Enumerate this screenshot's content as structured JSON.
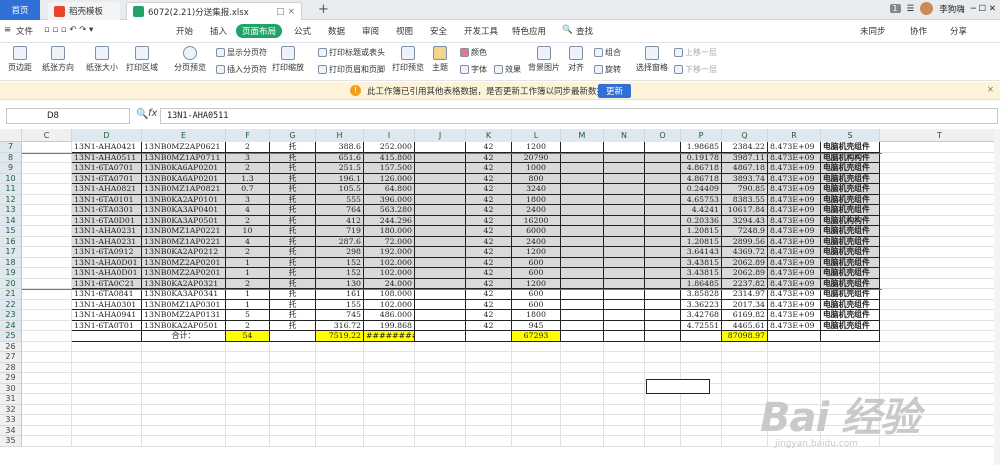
{
  "titlebar": {
    "home_tab": "首页",
    "tab1": "稻壳模板",
    "tab2": "6072(2.21)分送集报.xlsx",
    "add_tab": "+",
    "page_num": "1",
    "user": "李狗嗨"
  },
  "menu": {
    "file": "文件",
    "items": [
      "开始",
      "插入",
      "页面布局",
      "公式",
      "数据",
      "审阅",
      "视图",
      "安全",
      "开发工具",
      "特色应用",
      "查找"
    ],
    "active_index": 2,
    "right": [
      "未同步",
      "协作",
      "分享"
    ]
  },
  "ribbon": {
    "items": [
      "页边距",
      "纸张方向",
      "纸张大小",
      "打印区域",
      "分页预览",
      "显示分页符",
      "插入分页符",
      "打印缩放",
      "打印标题或表头",
      "打印页眉和页脚",
      "打印预览",
      "主题",
      "颜色",
      "字体",
      "效果",
      "背景图片",
      "对齐",
      "组合",
      "旋转",
      "选择窗格",
      "上移一层",
      "下移一层"
    ]
  },
  "notification": {
    "message": "此工作簿已引用其他表格数据，是否更新工作簿以同步最新数据？",
    "update_button": "更新",
    "close": "×"
  },
  "formula_bar": {
    "cell_ref": "D8",
    "zoom_icon": "🔍",
    "fx": "fx",
    "value": "13N1-AHA0511"
  },
  "columns": [
    "C",
    "D",
    "E",
    "F",
    "G",
    "H",
    "I",
    "J",
    "K",
    "L",
    "M",
    "N",
    "O",
    "P",
    "Q",
    "R",
    "S",
    "T"
  ],
  "rows": [
    {
      "n": "7",
      "D": "13N1-AHA0421",
      "E": "13NB0MZ2AP0621",
      "F": "2",
      "G": "托",
      "H": "388.6",
      "I": "252.000",
      "K": "42",
      "L": "1200",
      "P": "1.98685",
      "Q": "2384.22",
      "R": "8.473E+09",
      "S": "电脑机壳组件",
      "hl": false
    },
    {
      "n": "8",
      "D": "13N1-AHA0511",
      "E": "13NB0MZ1AP0711",
      "F": "3",
      "G": "托",
      "H": "651.6",
      "I": "415.800",
      "K": "42",
      "L": "20790",
      "P": "0.19178",
      "Q": "3987.11",
      "R": "8.473E+09",
      "S": "电脑机构构件",
      "hl": true
    },
    {
      "n": "9",
      "D": "13N1-6TA0701",
      "E": "13NB0KA6AP0201",
      "F": "2",
      "G": "托",
      "H": "251.5",
      "I": "157.500",
      "K": "42",
      "L": "1000",
      "P": "4.86718",
      "Q": "4867.18",
      "R": "8.473E+09",
      "S": "电脑机壳组件",
      "hl": true
    },
    {
      "n": "10",
      "D": "13N1-6TA0701",
      "E": "13NB0KA6AP0201",
      "F": "1.3",
      "G": "托",
      "H": "196.1",
      "I": "126.000",
      "K": "42",
      "L": "800",
      "P": "4.86718",
      "Q": "3893.74",
      "R": "8.473E+09",
      "S": "电脑机壳组件",
      "hl": true
    },
    {
      "n": "11",
      "D": "13N1-AHA0821",
      "E": "13NB0MZ1AP0821",
      "F": "0.7",
      "G": "托",
      "H": "105.5",
      "I": "64.800",
      "K": "42",
      "L": "3240",
      "P": "0.24409",
      "Q": "790.85",
      "R": "8.473E+09",
      "S": "电脑机壳组件",
      "hl": true
    },
    {
      "n": "12",
      "D": "13N1-6TA0101",
      "E": "13NB0KA2AP0101",
      "F": "3",
      "G": "托",
      "H": "555",
      "I": "396.000",
      "K": "42",
      "L": "1800",
      "P": "4.65753",
      "Q": "8383.55",
      "R": "8.473E+09",
      "S": "电脑机壳组件",
      "hl": true
    },
    {
      "n": "13",
      "D": "13N1-6TA0301",
      "E": "13NB0KA3AP0401",
      "F": "4",
      "G": "托",
      "H": "764",
      "I": "563.280",
      "K": "42",
      "L": "2400",
      "P": "4.4241",
      "Q": "10617.84",
      "R": "8.473E+09",
      "S": "电脑机壳组件",
      "hl": true
    },
    {
      "n": "14",
      "D": "13N1-6TA0D01",
      "E": "13NB0KA3AP0501",
      "F": "2",
      "G": "托",
      "H": "412",
      "I": "244.296",
      "K": "42",
      "L": "16200",
      "P": "0.20336",
      "Q": "3294.43",
      "R": "8.473E+09",
      "S": "电脑机构构件",
      "hl": true
    },
    {
      "n": "15",
      "D": "13N1-AHA0231",
      "E": "13NB0MZ1AP0221",
      "F": "10",
      "G": "托",
      "H": "719",
      "I": "180.000",
      "K": "42",
      "L": "6000",
      "P": "1.20815",
      "Q": "7248.9",
      "R": "8.473E+09",
      "S": "电脑机壳组件",
      "hl": true
    },
    {
      "n": "16",
      "D": "13N1-AHA0231",
      "E": "13NB0MZ1AP0221",
      "F": "4",
      "G": "托",
      "H": "287.6",
      "I": "72.000",
      "K": "42",
      "L": "2400",
      "P": "1.20815",
      "Q": "2899.56",
      "R": "8.473E+09",
      "S": "电脑机壳组件",
      "hl": true
    },
    {
      "n": "17",
      "D": "13N1-6TA0912",
      "E": "13NB0KA2AP0212",
      "F": "2",
      "G": "托",
      "H": "298",
      "I": "192.000",
      "K": "42",
      "L": "1200",
      "P": "3.64143",
      "Q": "4369.72",
      "R": "8.473E+09",
      "S": "电脑机壳组件",
      "hl": true
    },
    {
      "n": "18",
      "D": "13N1-AHA0D01",
      "E": "13NB0MZ2AP0201",
      "F": "1",
      "G": "托",
      "H": "152",
      "I": "102.000",
      "K": "42",
      "L": "600",
      "P": "3.43815",
      "Q": "2062.89",
      "R": "8.473E+09",
      "S": "电脑机壳组件",
      "hl": true
    },
    {
      "n": "19",
      "D": "13N1-AHA0D01",
      "E": "13NB0MZ2AP0201",
      "F": "1",
      "G": "托",
      "H": "152",
      "I": "102.000",
      "K": "42",
      "L": "600",
      "P": "3.43815",
      "Q": "2062.89",
      "R": "8.473E+09",
      "S": "电脑机壳组件",
      "hl": true
    },
    {
      "n": "20",
      "D": "13N1-6TA0C21",
      "E": "13NB0KA2AP0321",
      "F": "2",
      "G": "托",
      "H": "130",
      "I": "24.000",
      "K": "42",
      "L": "1200",
      "P": "1.86485",
      "Q": "2237.82",
      "R": "8.473E+09",
      "S": "电脑机壳组件",
      "hl": true
    },
    {
      "n": "21",
      "D": "13N1-6TA0841",
      "E": "13NB0KA3AP0341",
      "F": "1",
      "G": "托",
      "H": "161",
      "I": "108.000",
      "K": "42",
      "L": "600",
      "P": "3.85828",
      "Q": "2314.97",
      "R": "8.473E+09",
      "S": "电脑机壳组件",
      "hl": false
    },
    {
      "n": "22",
      "D": "13N1-AHA0301",
      "E": "13NB0MZ1AP0301",
      "F": "1",
      "G": "托",
      "H": "155",
      "I": "102.000",
      "K": "42",
      "L": "600",
      "P": "3.36223",
      "Q": "2017.34",
      "R": "8.473E+09",
      "S": "电脑机壳组件",
      "hl": false
    },
    {
      "n": "23",
      "D": "13N1-AHA0941",
      "E": "13NB0MZ2AP0131",
      "F": "5",
      "G": "托",
      "H": "745",
      "I": "486.000",
      "K": "42",
      "L": "1800",
      "P": "3.42768",
      "Q": "6169.82",
      "R": "8.473E+09",
      "S": "电脑机壳组件",
      "hl": false
    },
    {
      "n": "24",
      "D": "13N1-6TA0T01",
      "E": "13NB0KA2AP0501",
      "F": "2",
      "G": "托",
      "H": "316.72",
      "I": "199.868",
      "K": "42",
      "L": "945",
      "P": "4.72551",
      "Q": "4465.61",
      "R": "8.473E+09",
      "S": "电脑机壳组件",
      "hl": false
    }
  ],
  "total_row": {
    "n": "25",
    "label": "合计：",
    "F": "54",
    "H": "7519.22",
    "I": "########",
    "L": "67293",
    "Q": "87098.97"
  },
  "empty_rows": [
    "26",
    "27",
    "28",
    "29",
    "30",
    "31",
    "32",
    "33",
    "34",
    "35"
  ],
  "watermark": {
    "brand": "Bai 经验",
    "url": "jingyan.baidu.com"
  }
}
